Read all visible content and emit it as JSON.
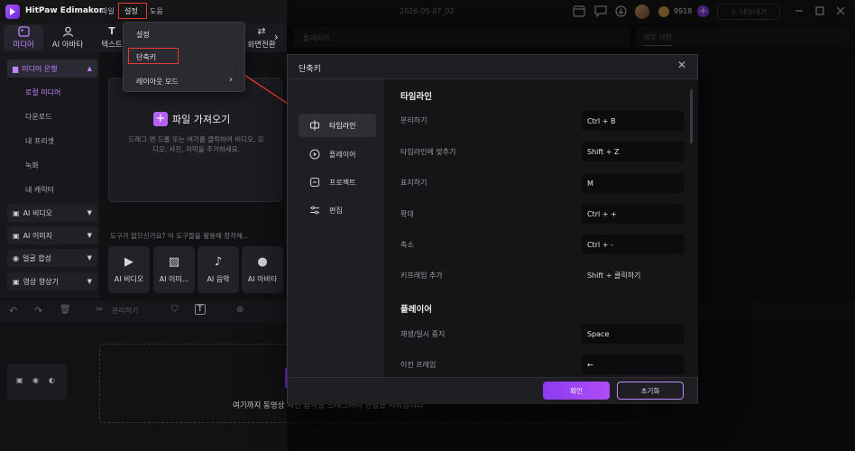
{
  "titlebar": {
    "app_name": "HitPaw Edimakor",
    "menus": {
      "file": "파일",
      "settings": "설정",
      "help": "도움"
    },
    "project_name": "2026-05-07_02",
    "credits": "9918",
    "export_label": "내보내기"
  },
  "toolbar": {
    "media": "미디어",
    "ai_avatar": "AI 아바타",
    "text": "텍스트",
    "transition": "화면전환"
  },
  "left_panel": {
    "media_resources": "미디어 은행",
    "local_media": "로컬 미디어",
    "download": "다운로드",
    "my_presets": "내 프리셋",
    "recording": "녹화",
    "my_character": "내 캐릭터",
    "ai_video": "AI 비디오",
    "ai_image": "AI 이미지",
    "face_synthesis": "얼굴 합성",
    "video_enhancer": "영상 향상기"
  },
  "import": {
    "title": "파일 가져오기",
    "description": "드래그 앤 드롭 또는 여기를 클릭하여 비디오, 오디오, 사진, 자막을 추가하세요."
  },
  "no_tools_hint": "도구가 없으신가요? 이 도구들을 활용해 창작해...",
  "ai_cards": [
    "AI 비디오",
    "AI 이미...",
    "AI 음악",
    "AI 아바타"
  ],
  "preview_header": "플레이어",
  "details_tab": "세부 사항",
  "timeline": {
    "split_label": "분리하기",
    "hint": "여기까지 동영상 사진 음악을 드래그하여 편집을 시작합니다"
  },
  "dropdown": {
    "settings": "설정",
    "shortcuts": "단축키",
    "layout_mode": "레이아웃 모드"
  },
  "dialog": {
    "title": "단축키",
    "nav": {
      "timeline": "타임라인",
      "player": "플레이어",
      "project": "프로젝트",
      "edit": "편집"
    },
    "sections": {
      "timeline_title": "타임라인",
      "player_title": "플레이어"
    },
    "shortcuts": [
      {
        "label": "분리하기",
        "key": "Ctrl + B"
      },
      {
        "label": "타임라인에 맞추기",
        "key": "Shift + Z"
      },
      {
        "label": "표지하기",
        "key": "M"
      },
      {
        "label": "확대",
        "key": "Ctrl + +"
      },
      {
        "label": "축소",
        "key": "Ctrl + -"
      },
      {
        "label": "키프레임 추가",
        "key": "Shift + 클릭하기"
      }
    ],
    "player_shortcuts": [
      {
        "label": "재생/일시 중지",
        "key": "Space"
      },
      {
        "label": "이전 프레임",
        "key": "←"
      }
    ],
    "confirm": "확인",
    "reset": "초기화"
  },
  "colors": {
    "accent": "#b14cf7",
    "annotation_red": "#e53935"
  }
}
